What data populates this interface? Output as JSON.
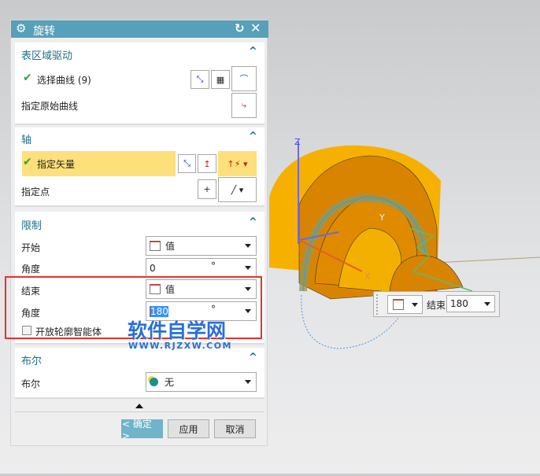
{
  "dialog": {
    "title": "旋转",
    "sections": {
      "surface": {
        "title": "表区域驱动",
        "select_curve": "选择曲线 (9)",
        "specify_original": "指定原始曲线"
      },
      "axis": {
        "title": "轴",
        "specify_vector": "指定矢量",
        "specify_point": "指定点"
      },
      "limits": {
        "title": "限制",
        "start_label": "开始",
        "start_mode": "值",
        "start_angle_label": "角度",
        "start_angle": "0",
        "end_label": "结束",
        "end_mode": "值",
        "end_angle_label": "角度",
        "end_angle": "180",
        "unit": "°",
        "open_profile": "开放轮廓智能体"
      },
      "boolean": {
        "title": "布尔",
        "label": "布尔",
        "value": "无"
      }
    },
    "buttons": {
      "ok": "< 确定 >",
      "apply": "应用",
      "cancel": "取消"
    }
  },
  "watermark": {
    "title": "软件自学网",
    "url": "WWW.RJZXW.COM"
  },
  "viewport": {
    "axis_z": "Z",
    "axis_y": "Y",
    "axis_x": "X",
    "float_label": "结束",
    "float_value": "180"
  },
  "colors": {
    "title_bar": "#56a0b9",
    "highlight": "#fde07a",
    "part": "#f0a000",
    "highlight_box": "#e83030"
  }
}
